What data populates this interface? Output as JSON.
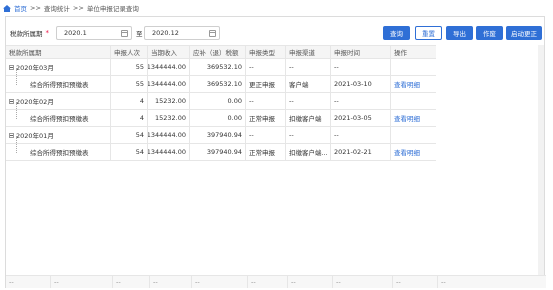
{
  "breadcrumb": {
    "home": "首页",
    "sep1": ">>",
    "level1": "查询统计",
    "sep2": ">>",
    "level2": "单位申报记录查询"
  },
  "filter": {
    "label": "税款所属期",
    "required_mark": "*",
    "start": "2020.1",
    "to": "至",
    "end": "2020.12"
  },
  "buttons": {
    "query": "查询",
    "reset": "重置",
    "export": "导出",
    "void": "作废",
    "correct": "启动更正"
  },
  "columns": [
    "税款所属期",
    "申报人次",
    "当期收入",
    "应补（退）税额",
    "申报类型",
    "申报渠道",
    "申报时间",
    "操作"
  ],
  "rows": [
    {
      "period": "2020年03月",
      "count": "55",
      "income": "1344444.00",
      "tax": "369532.10",
      "type": "--",
      "channel": "--",
      "time": "--",
      "op": ""
    },
    {
      "period": "综合所得预扣预缴表",
      "count": "55",
      "income": "1344444.00",
      "tax": "369532.10",
      "type": "更正申报",
      "channel": "客户端",
      "time": "2021-03-10",
      "op": "查看明细"
    },
    {
      "period": "2020年02月",
      "count": "4",
      "income": "15232.00",
      "tax": "0.00",
      "type": "--",
      "channel": "--",
      "time": "--",
      "op": ""
    },
    {
      "period": "综合所得预扣预缴表",
      "count": "4",
      "income": "15232.00",
      "tax": "0.00",
      "type": "正常申报",
      "channel": "扣缴客户端",
      "time": "2021-03-05",
      "op": "查看明细"
    },
    {
      "period": "2020年01月",
      "count": "54",
      "income": "1344444.00",
      "tax": "397940.94",
      "type": "--",
      "channel": "--",
      "time": "--",
      "op": ""
    },
    {
      "period": "综合所得预扣预缴表",
      "count": "54",
      "income": "1344444.00",
      "tax": "397940.94",
      "type": "正常申报",
      "channel": "扣缴客户端...",
      "time": "2021-02-21",
      "op": "查看明细"
    }
  ],
  "footer": [
    "--",
    "--",
    "--",
    "--",
    "--",
    "--",
    "--",
    "--",
    "--",
    "--"
  ],
  "colors": {
    "accent": "#2f6fd6",
    "required": "#ee1144"
  }
}
